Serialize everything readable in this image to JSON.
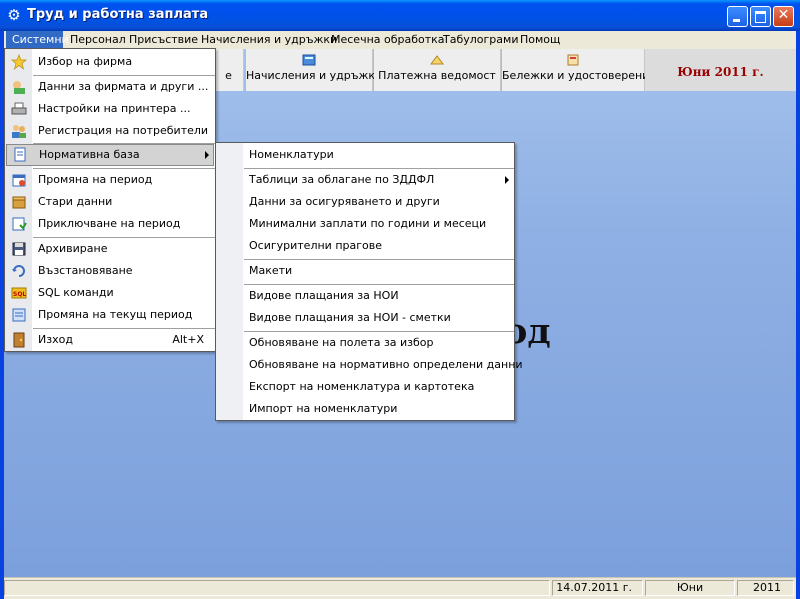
{
  "window": {
    "title": "Труд и работна заплата",
    "icon": "gear-icon"
  },
  "menubar": {
    "items": [
      {
        "label": "Системни"
      },
      {
        "label": "Персонал"
      },
      {
        "label": "Присъствие"
      },
      {
        "label": "Начисления и удръжки"
      },
      {
        "label": "Месечна обработка"
      },
      {
        "label": "Табулограми"
      },
      {
        "label": "Помощ"
      }
    ]
  },
  "toolbar": {
    "partial_label": "е",
    "tiles": [
      {
        "label": "Начисления и удръжки",
        "icon": "calculator-icon"
      },
      {
        "label": "Платежна ведомост",
        "icon": "money-icon"
      },
      {
        "label": "Бележки и удостоверения",
        "icon": "certificate-icon"
      }
    ],
    "period": "Юни 2011 г."
  },
  "background_text": "од",
  "statusbar": {
    "main": "",
    "date": "14.07.2011 г.",
    "month": "Юни",
    "year": "2011"
  },
  "menu_sistemni": {
    "items": [
      {
        "label": "Избор на фирма",
        "icon": "star-icon"
      },
      {
        "label": "Данни за фирмата и други ...",
        "icon": "company-icon"
      },
      {
        "label": "Настройки на принтера ...",
        "icon": "printer-icon"
      },
      {
        "label": "Регистрация на потребители",
        "icon": "users-icon"
      },
      {
        "label": "Нормативна база",
        "icon": "document-icon"
      },
      {
        "label": "Промяна на период",
        "icon": "calendar-icon"
      },
      {
        "label": "Стари данни",
        "icon": "box-icon"
      },
      {
        "label": "Приключване на период",
        "icon": "lock-period-icon"
      },
      {
        "label": "Архивиране",
        "icon": "save-icon"
      },
      {
        "label": "Възстановяване",
        "icon": "restore-icon"
      },
      {
        "label": "SQL команди",
        "icon": "sql-icon"
      },
      {
        "label": "Промяна на текущ период",
        "icon": "edit-period-icon"
      },
      {
        "label": "Изход",
        "shortcut": "Alt+X",
        "icon": "exit-icon"
      }
    ]
  },
  "menu_normativna": {
    "items": [
      {
        "label": "Номенклатури"
      },
      {
        "label": "Таблици за облагане по ЗДДФЛ"
      },
      {
        "label": "Данни за осигуряването и други"
      },
      {
        "label": "Минимални заплати по години и месеци"
      },
      {
        "label": "Осигурителни прагове"
      },
      {
        "label": "Макети"
      },
      {
        "label": "Видове плащания за НОИ"
      },
      {
        "label": "Видове плащания за НОИ - сметки"
      },
      {
        "label": "Обновяване на полета за избор"
      },
      {
        "label": "Обновяване на нормативно определени данни"
      },
      {
        "label": "Експорт на номенклатура и картотека"
      },
      {
        "label": "Импорт  на номенклатури"
      }
    ]
  }
}
